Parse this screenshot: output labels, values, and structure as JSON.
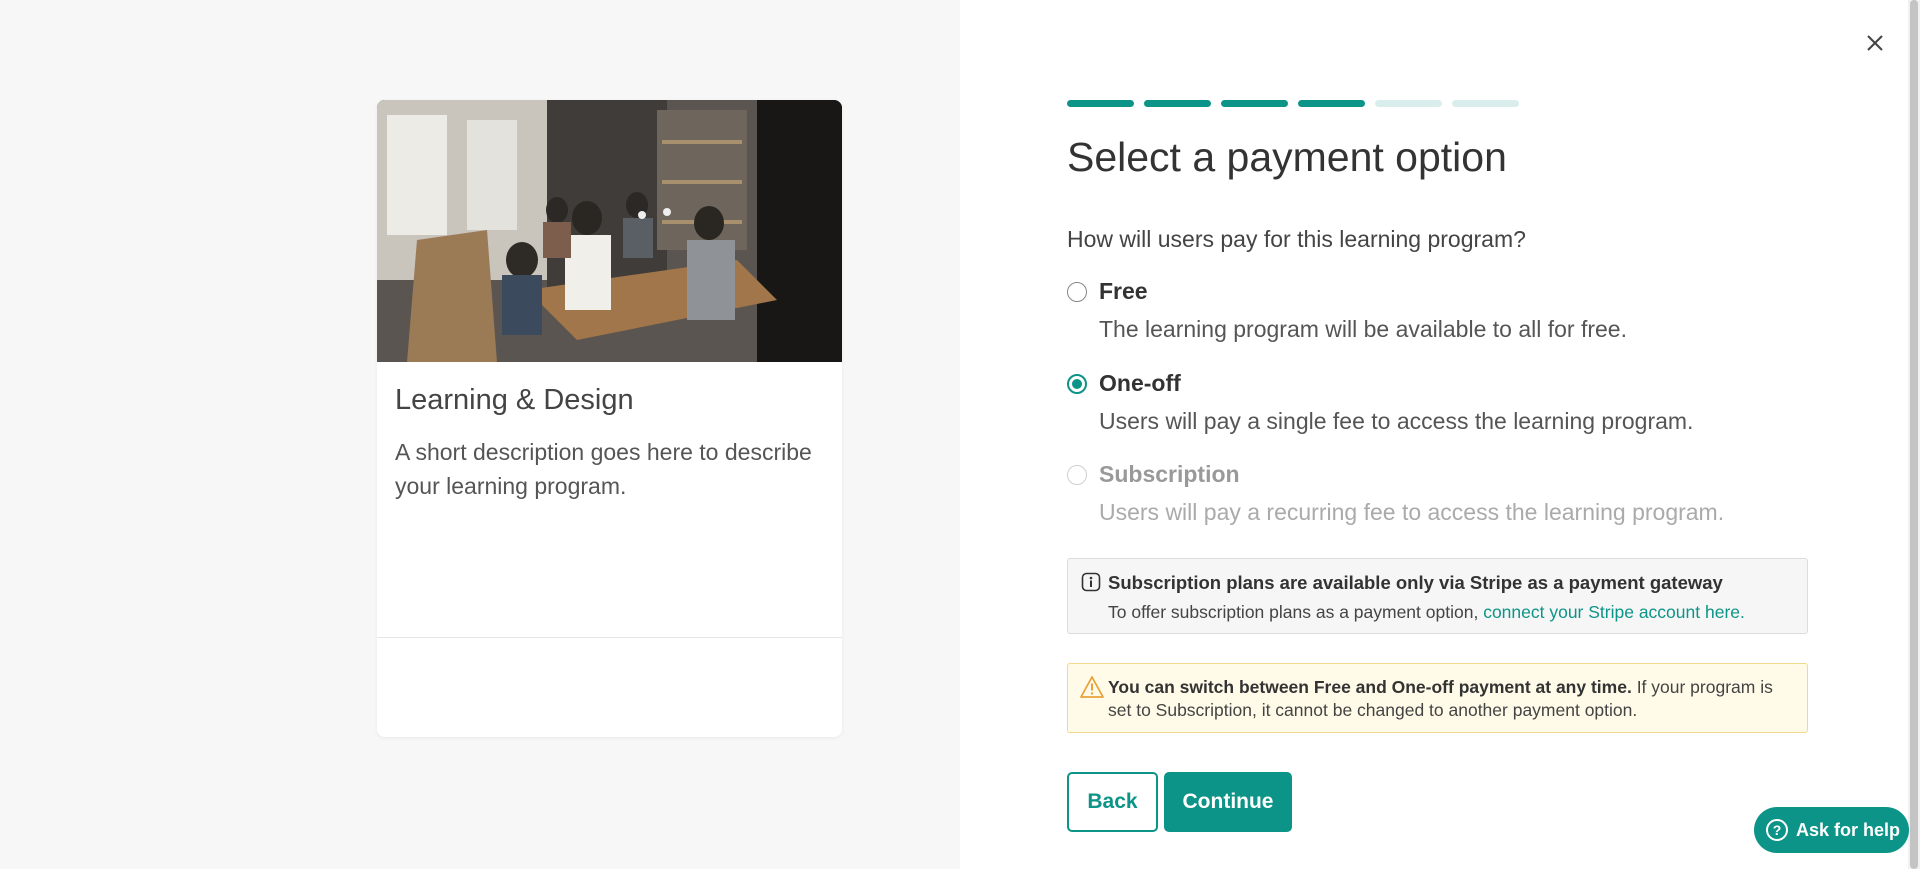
{
  "preview": {
    "title": "Learning & Design",
    "description": "A short description goes here to describe your learning program."
  },
  "dialog": {
    "close_icon": "close-icon",
    "stepper": {
      "total_steps": 6,
      "completed_steps": 4
    },
    "title": "Select a payment option",
    "question": "How will users pay for this learning program?",
    "options": [
      {
        "label": "Free",
        "description": "The learning program will be available to all for free.",
        "selected": false,
        "disabled": false
      },
      {
        "label": "One-off",
        "description": "Users will pay a single fee to access the learning program.",
        "selected": true,
        "disabled": false
      },
      {
        "label": "Subscription",
        "description": "Users will pay a recurring fee to access the learning program.",
        "selected": false,
        "disabled": true
      }
    ],
    "info": {
      "icon": "info-icon",
      "title": "Subscription plans are available only via Stripe as a payment gateway",
      "text": "To offer subscription plans as a payment option,",
      "link": "connect your Stripe account here."
    },
    "warning": {
      "icon": "warning-icon",
      "strong": "You can switch between Free and One-off payment at any time.",
      "text": "If your program is set to Subscription, it cannot be changed to another payment option."
    },
    "buttons": {
      "back": "Back",
      "continue": "Continue"
    },
    "help": {
      "label": "Ask for help",
      "icon": "help-icon"
    }
  },
  "colors": {
    "accent": "#0d9488",
    "step_inactive": "#d9eeec",
    "left_background": "#f7f7f7",
    "warning_background": "#fffbe8"
  }
}
